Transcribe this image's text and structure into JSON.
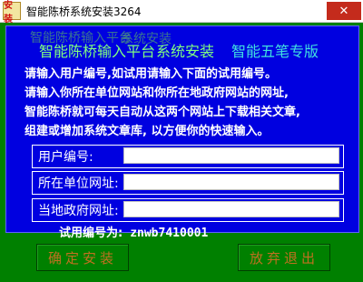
{
  "window": {
    "icon_text": "安装",
    "title": "智能陈桥系统安装3264",
    "close_glyph": "✕"
  },
  "header": {
    "ghost_title": "智能陈桥输入平台",
    "ghost_sub": "系统安装",
    "title": "智能陈桥输入平台",
    "subtitle": "系统安装",
    "edition": "智能五笔专版"
  },
  "instructions": [
    "请输入用户编号,如试用请输入下面的试用编号。",
    "请输入你所在单位网站和你所在地政府网站的网址,",
    "智能陈桥就可每天自动从这两个网站上下载相关文章,",
    "组建或增加系统文章库, 以方便你的快速输入。"
  ],
  "form": {
    "user_id_label": "用户编号:",
    "user_id_value": "",
    "unit_site_label": "所在单位网址:",
    "unit_site_value": "",
    "gov_site_label": "当地政府网址:",
    "gov_site_value": ""
  },
  "trial": {
    "label": "试用编号为:",
    "code": "znwb7410001"
  },
  "buttons": {
    "install": "确定安装",
    "quit": "放弃退出"
  },
  "colors": {
    "background": "#008000",
    "panel": "#0000e0",
    "title_green": "#80ff80",
    "edition_cyan": "#40e0e0",
    "button_text": "#c07020"
  }
}
